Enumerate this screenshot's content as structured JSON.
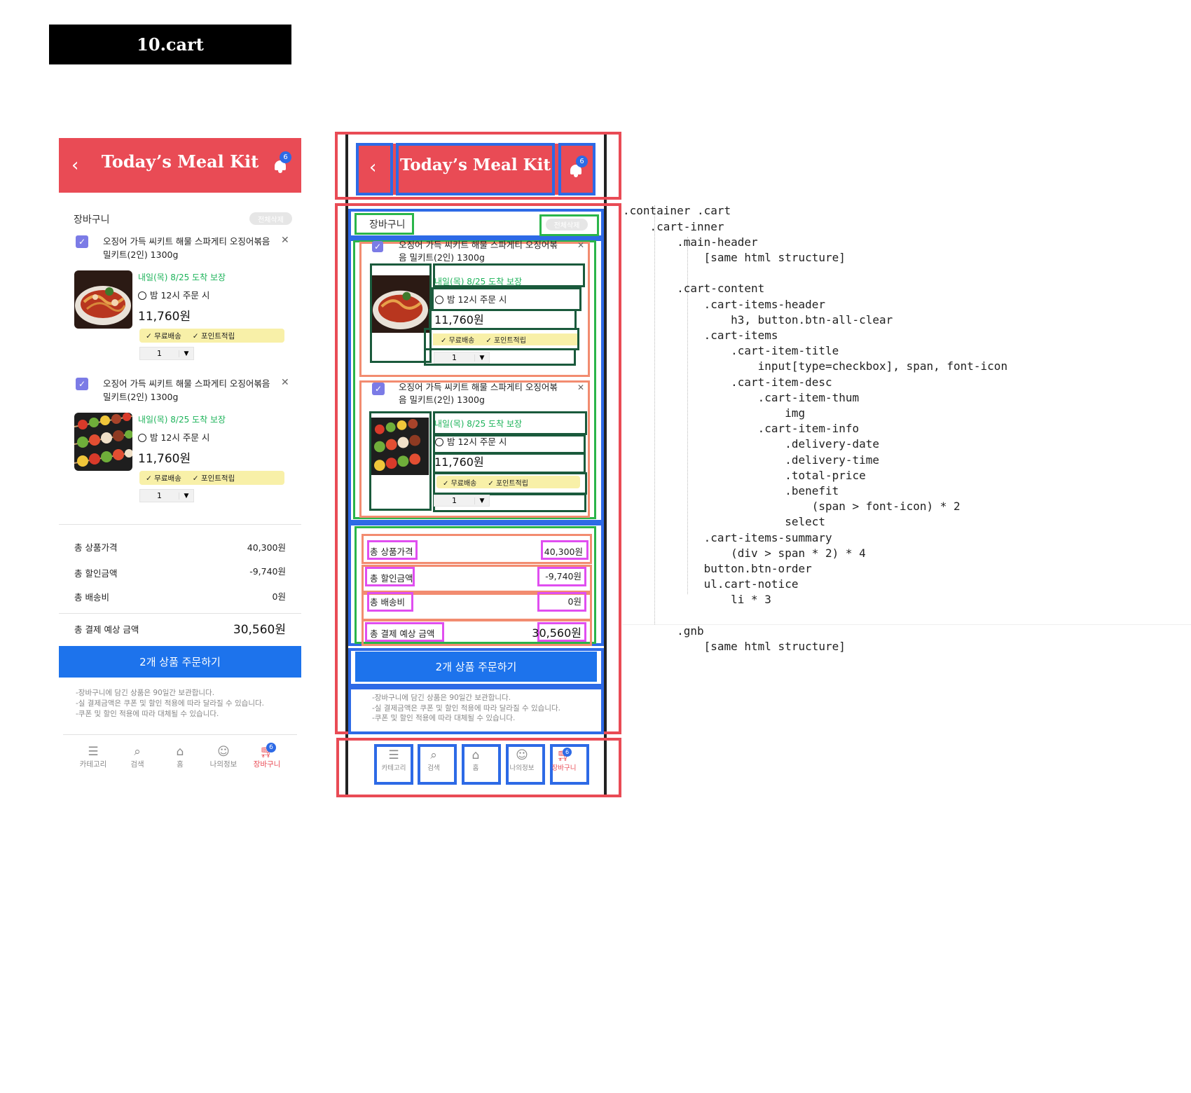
{
  "page_badge": "10.cart",
  "header": {
    "title": "Today’s Meal Kit",
    "back_icon": "chevron-left-icon",
    "bell_icon": "bell-icon",
    "badge_count": "6"
  },
  "cart": {
    "title": "장바구니",
    "clear_all_label": "전체삭제",
    "items": [
      {
        "title": "오징어 가득 씨키트 해물 스파게티 오징어볶음 밀키트(2인) 1300g",
        "thumb": "squid-pasta-image",
        "delivery_date": "내일(목) 8/25 도착 보장",
        "delivery_time": "밤 12시 주문 시",
        "price": "11,760원",
        "benefits": [
          "무료배송",
          "포인트적립"
        ],
        "qty": "1"
      },
      {
        "title": "오징어 가득 씨키트 해물 스파게티 오징어볶음 밀키트(2인) 1300g",
        "thumb": "vegetable-skewers-image",
        "delivery_date": "내일(목) 8/25 도착 보장",
        "delivery_time": "밤 12시 주문 시",
        "price": "11,760원",
        "benefits": [
          "무료배송",
          "포인트적립"
        ],
        "qty": "1"
      }
    ],
    "summary": [
      {
        "label": "총 상품가격",
        "value": "40,300원"
      },
      {
        "label": "총 할인금액",
        "value": "-9,740원"
      },
      {
        "label": "총 배송비",
        "value": "0원"
      }
    ],
    "total": {
      "label": "총 결제 예상 금액",
      "value": "30,560원"
    },
    "order_label": "2개 상품 주문하기",
    "notices": [
      "-장바구니에 담긴 상품은 90일간 보관합니다.",
      "-실 결제금액은 쿠폰 및 할인 적용에 따라 달라질 수 있습니다.",
      "-쿠폰 및 할인 적용에 따라 대체될 수 있습니다."
    ]
  },
  "gnb": [
    {
      "label": "카테고리",
      "icon": "menu-icon"
    },
    {
      "label": "검색",
      "icon": "search-icon"
    },
    {
      "label": "홈",
      "icon": "home-icon"
    },
    {
      "label": "나의정보",
      "icon": "user-icon"
    },
    {
      "label": "장바구니",
      "icon": "cart-icon",
      "active": true,
      "badge": "6"
    }
  ],
  "code_tree": [
    ".container .cart",
    "    .cart-inner",
    "        .main-header",
    "            [same html structure]",
    "",
    "        .cart-content",
    "            .cart-items-header",
    "                h3, button.btn-all-clear",
    "            .cart-items",
    "                .cart-item-title",
    "                    input[type=checkbox], span, font-icon",
    "                .cart-item-desc",
    "                    .cart-item-thum",
    "                        img",
    "                    .cart-item-info",
    "                        .delivery-date",
    "                        .delivery-time",
    "                        .total-price",
    "                        .benefit",
    "                            (span > font-icon) * 2",
    "                        select",
    "            .cart-items-summary",
    "                (div > span * 2) * 4",
    "            button.btn-order",
    "            ul.cart-notice",
    "                li * 3",
    "",
    "        .gnb",
    "            [same html structure]"
  ],
  "colors": {
    "brand_red": "#e94b55",
    "order_blue": "#1d73ec",
    "delivery_green": "#1db35a",
    "benefit_yellow": "#f8f0a8"
  }
}
